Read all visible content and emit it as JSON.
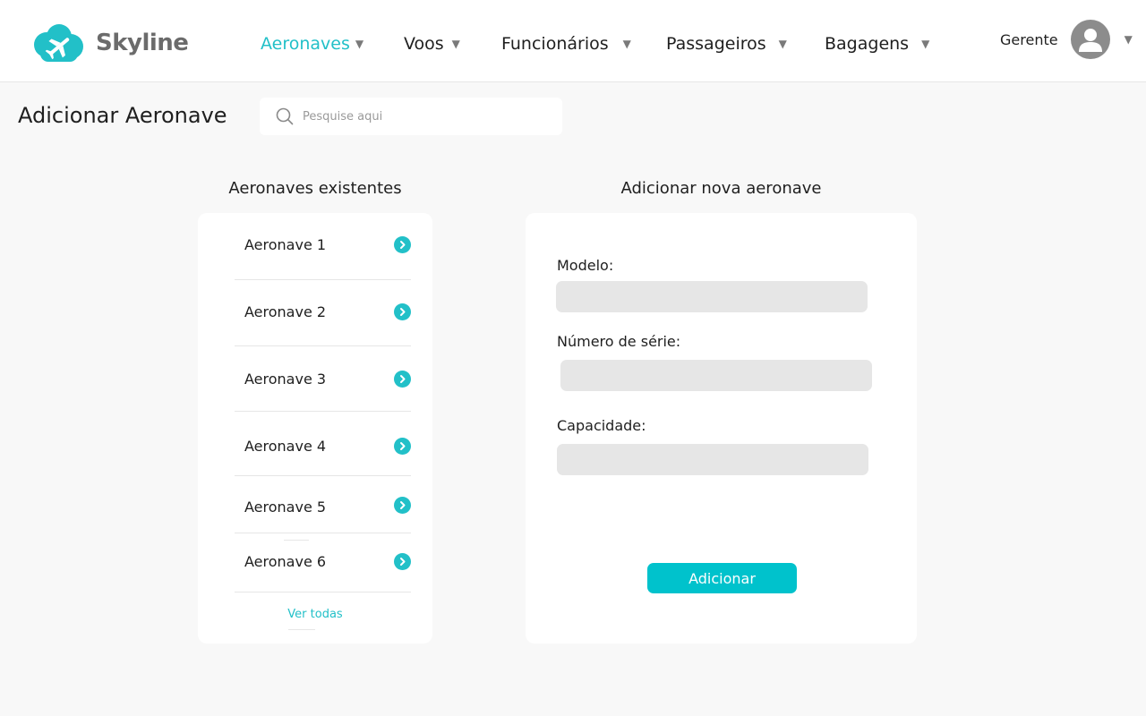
{
  "colors": {
    "accent": "#22c0c8",
    "button": "#00c2cc",
    "input_bg": "#e6e6e6",
    "page_bg": "#f8f8f8"
  },
  "brand": {
    "name": "Skyline",
    "logo_icon": "cloud-airplane-icon"
  },
  "nav": {
    "items": [
      {
        "label": "Aeronaves",
        "active": true
      },
      {
        "label": "Voos",
        "active": false
      },
      {
        "label": "Funcionários",
        "active": false
      },
      {
        "label": "Passageiros",
        "active": false
      },
      {
        "label": "Bagagens",
        "active": false
      }
    ],
    "caret_icon": "caret-down-icon"
  },
  "user": {
    "name": "Gerente",
    "avatar_icon": "user-avatar-icon"
  },
  "page": {
    "title": "Adicionar Aeronave"
  },
  "search": {
    "placeholder": "Pesquise aqui",
    "icon": "search-icon"
  },
  "existing": {
    "title": "Aeronaves existentes",
    "items": [
      {
        "label": "Aeronave 1"
      },
      {
        "label": "Aeronave 2"
      },
      {
        "label": "Aeronave 3"
      },
      {
        "label": "Aeronave 4"
      },
      {
        "label": "Aeronave 5"
      },
      {
        "label": "Aeronave 6"
      }
    ],
    "item_icon": "chevron-right-icon",
    "see_all": "Ver todas"
  },
  "form": {
    "title": "Adicionar nova aeronave",
    "fields": [
      {
        "label": "Modelo:",
        "value": ""
      },
      {
        "label": "Número de série:",
        "value": ""
      },
      {
        "label": "Capacidade:",
        "value": ""
      }
    ],
    "submit": "Adicionar"
  }
}
